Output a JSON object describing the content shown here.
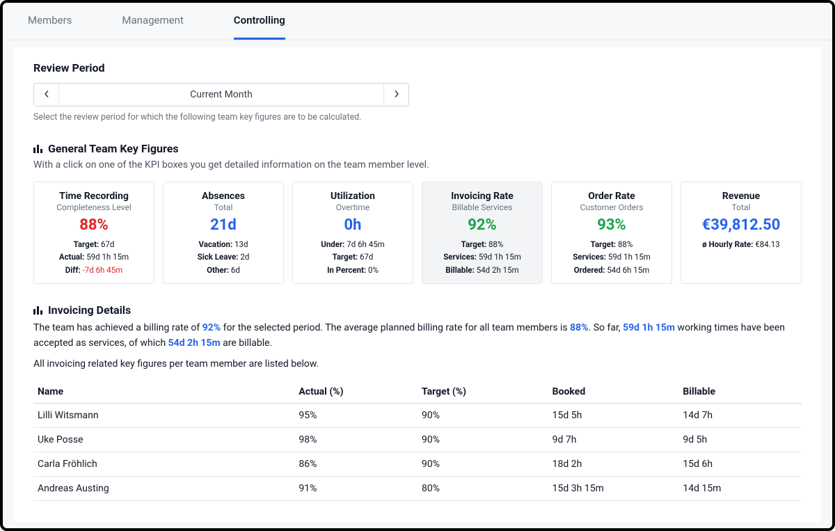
{
  "tabs": {
    "members": "Members",
    "management": "Management",
    "controlling": "Controlling"
  },
  "reviewPeriod": {
    "title": "Review Period",
    "value": "Current Month",
    "help": "Select the review period for which the following team key figures are to be calculated."
  },
  "general": {
    "title": "General Team Key Figures",
    "help": "With a click on one of the KPI boxes you get detailed information on the team member level."
  },
  "kpis": [
    {
      "title": "Time Recording",
      "sub": "Completeness Level",
      "value": "88%",
      "color": "red",
      "lines": [
        {
          "label": "Target:",
          "value": "67d"
        },
        {
          "label": "Actual:",
          "value": "59d 1h 15m"
        },
        {
          "label": "Diff:",
          "value": "-7d 6h 45m",
          "diffRed": true
        }
      ]
    },
    {
      "title": "Absences",
      "sub": "Total",
      "value": "21d",
      "color": "blue",
      "lines": [
        {
          "label": "Vacation:",
          "value": "13d"
        },
        {
          "label": "Sick Leave:",
          "value": "2d"
        },
        {
          "label": "Other:",
          "value": "6d"
        }
      ]
    },
    {
      "title": "Utilization",
      "sub": "Overtime",
      "value": "0h",
      "color": "blue",
      "lines": [
        {
          "label": "Under:",
          "value": "7d 6h 45m"
        },
        {
          "label": "Target:",
          "value": "67d"
        },
        {
          "label": "In Percent:",
          "value": "0%"
        }
      ]
    },
    {
      "title": "Invoicing Rate",
      "sub": "Billable Services",
      "value": "92%",
      "color": "green",
      "selected": true,
      "lines": [
        {
          "label": "Target:",
          "value": "88%"
        },
        {
          "label": "Services:",
          "value": "59d 1h 15m"
        },
        {
          "label": "Billable:",
          "value": "54d 2h 15m"
        }
      ]
    },
    {
      "title": "Order Rate",
      "sub": "Customer Orders",
      "value": "93%",
      "color": "green",
      "lines": [
        {
          "label": "Target:",
          "value": "88%"
        },
        {
          "label": "Services:",
          "value": "59d 1h 15m"
        },
        {
          "label": "Ordered:",
          "value": "54d 6h 15m"
        }
      ]
    },
    {
      "title": "Revenue",
      "sub": "Total",
      "value": "€39,812.50",
      "color": "blue",
      "lines": [
        {
          "label": "ø Hourly Rate:",
          "value": "€84.13"
        }
      ]
    }
  ],
  "invoicingDetails": {
    "title": "Invoicing Details",
    "text1a": "The team has achieved a billing rate of ",
    "hl1": "92%",
    "text1b": " for the selected period. The average planned billing rate for all team members is ",
    "hl2": "88%",
    "text1c": ". So far, ",
    "hl3": "59d 1h 15m",
    "text1d": " working times have been accepted as services, of which ",
    "hl4": "54d 2h 15m",
    "text1e": " are billable.",
    "sub": "All invoicing related key figures per team member are listed below."
  },
  "table": {
    "headers": {
      "name": "Name",
      "actual": "Actual (%)",
      "target": "Target (%)",
      "booked": "Booked",
      "billable": "Billable"
    },
    "rows": [
      {
        "name": "Lilli Witsmann",
        "actual": "95%",
        "target": "90%",
        "booked": "15d 5h",
        "billable": "14d 7h"
      },
      {
        "name": "Uke Posse",
        "actual": "98%",
        "target": "90%",
        "booked": "9d 7h",
        "billable": "9d 5h"
      },
      {
        "name": "Carla Fröhlich",
        "actual": "86%",
        "target": "90%",
        "booked": "18d 2h",
        "billable": "15d 6h"
      },
      {
        "name": "Andreas Austing",
        "actual": "91%",
        "target": "80%",
        "booked": "15d 3h 15m",
        "billable": "14d 15m"
      }
    ]
  }
}
